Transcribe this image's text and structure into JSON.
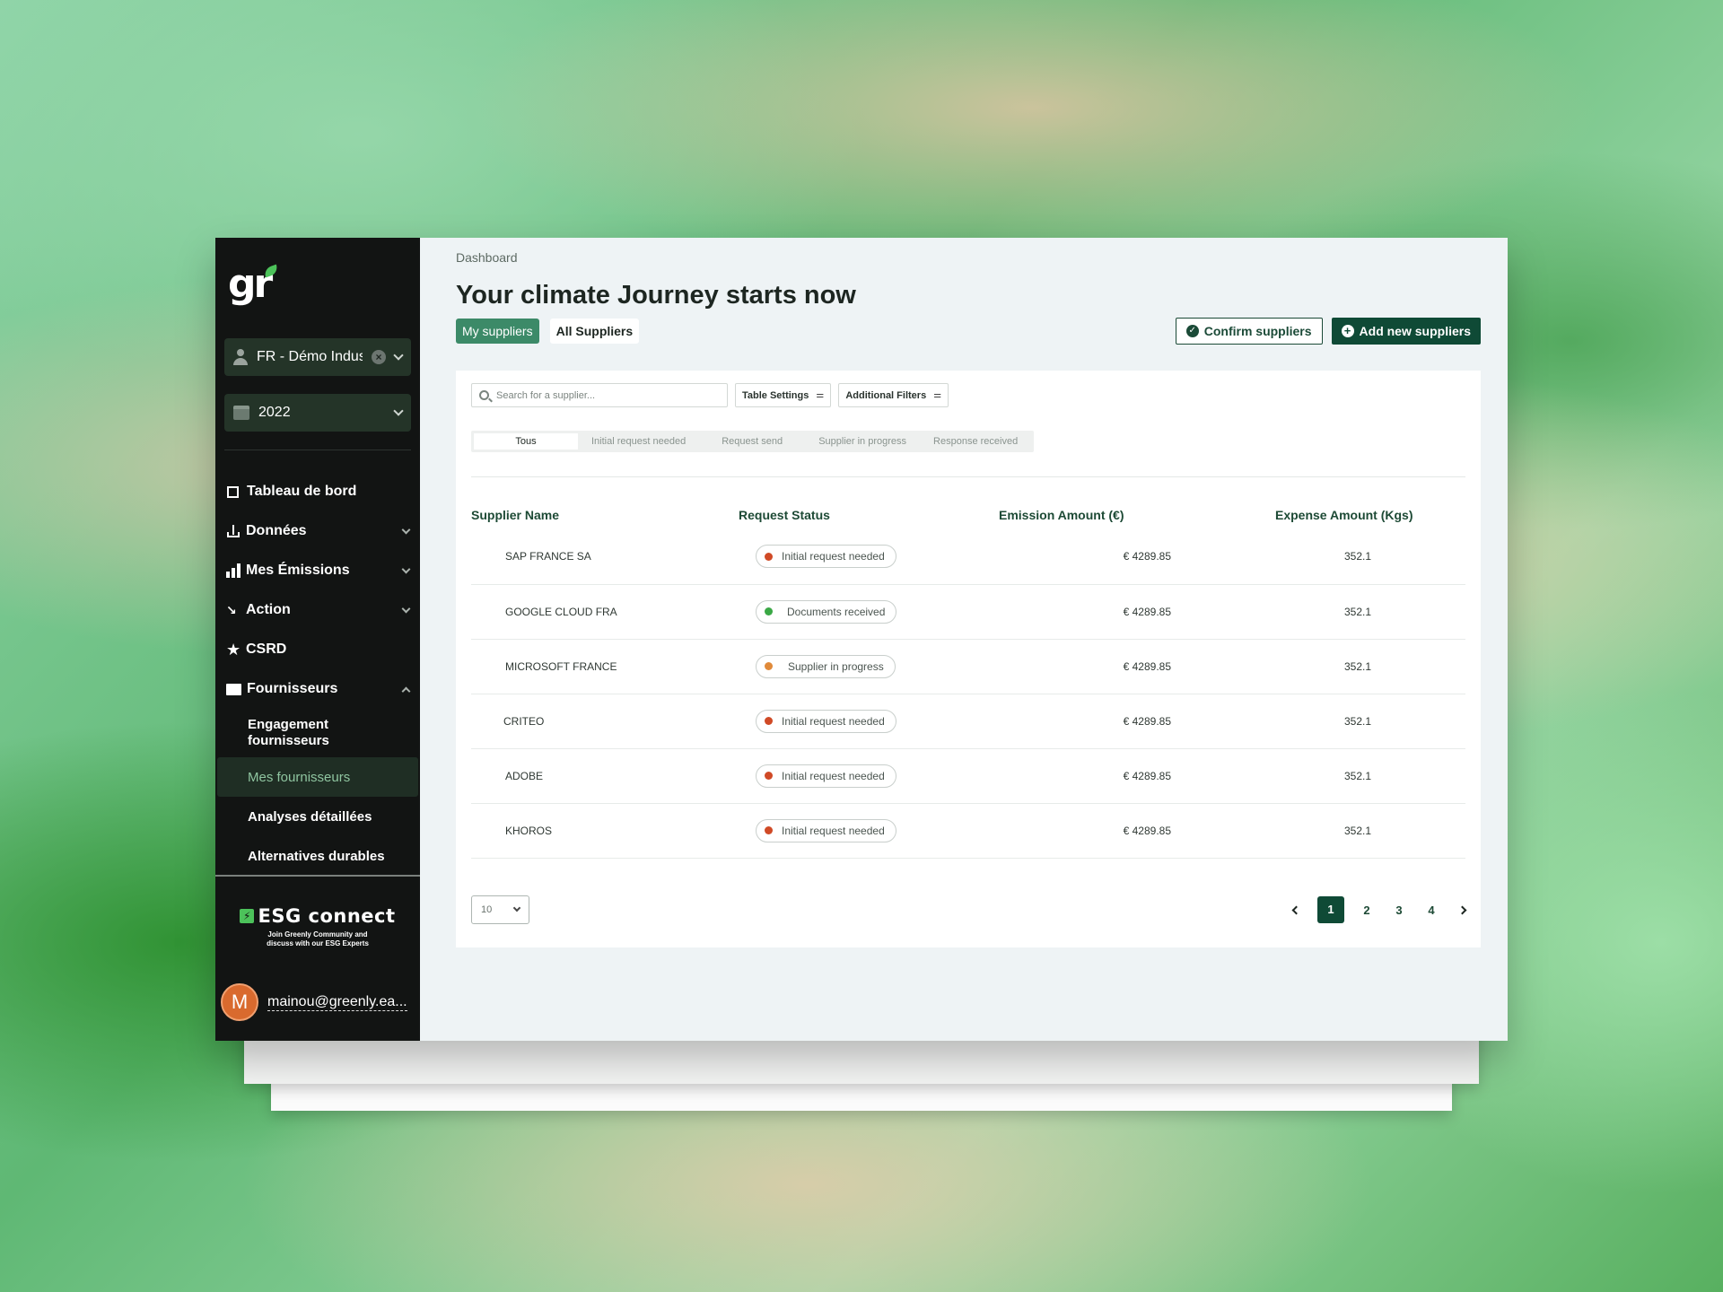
{
  "sidebar": {
    "logo": "gr",
    "company_select": "FR - Démo Industrie",
    "year_select": "2022",
    "nav": [
      {
        "label": "Tableau de bord"
      },
      {
        "label": "Données"
      },
      {
        "label": "Mes Émissions"
      },
      {
        "label": "Action"
      },
      {
        "label": "CSRD"
      },
      {
        "label": "Fournisseurs"
      }
    ],
    "sub_nav": [
      {
        "label": "Engagement fournisseurs"
      },
      {
        "label": "Mes fournisseurs"
      },
      {
        "label": "Analyses détaillées"
      },
      {
        "label": "Alternatives durables"
      }
    ],
    "esg_title": "ESG connect",
    "esg_sub_1": "Join Greenly Community and",
    "esg_sub_2": "discuss with our ESG Experts",
    "user_initial": "M",
    "user_email": "mainou@greenly.ea..."
  },
  "main": {
    "breadcrumb": "Dashboard",
    "title": "Your climate Journey starts now",
    "tabs": [
      {
        "label": "My suppliers"
      },
      {
        "label": "All Suppliers"
      }
    ],
    "confirm_label": "Confirm suppliers",
    "add_label": "Add new suppliers",
    "search_placeholder": "Search for a supplier...",
    "table_settings": "Table Settings",
    "additional_filters": "Additional Filters",
    "status_tabs": [
      {
        "label": "Tous"
      },
      {
        "label": "Initial request needed"
      },
      {
        "label": "Request send"
      },
      {
        "label": "Supplier in progress"
      },
      {
        "label": "Response received"
      }
    ],
    "columns": [
      "Supplier Name",
      "Request Status",
      "Emission Amount (€)",
      "Expense Amount (Kgs)"
    ],
    "rows": [
      {
        "name": "SAP FRANCE SA",
        "status": "Initial request needed",
        "emission": "€ 4289.85",
        "expense": "352.1"
      },
      {
        "name": "GOOGLE CLOUD FRA",
        "status": "Documents received",
        "emission": "€ 4289.85",
        "expense": "352.1"
      },
      {
        "name": "MICROSOFT FRANCE",
        "status": "Supplier in progress",
        "emission": "€ 4289.85",
        "expense": "352.1"
      },
      {
        "name": "CRITEO",
        "status": "Initial request needed",
        "emission": "€ 4289.85",
        "expense": "352.1"
      },
      {
        "name": "ADOBE",
        "status": "Initial request needed",
        "emission": "€ 4289.85",
        "expense": "352.1"
      },
      {
        "name": "KHOROS",
        "status": "Initial request needed",
        "emission": "€ 4289.85",
        "expense": "352.1"
      }
    ],
    "page_size": "10",
    "pages": [
      "1",
      "2",
      "3",
      "4"
    ]
  },
  "colors": {
    "status_red": "#d04a26",
    "status_green": "#3aa845",
    "status_orange": "#e08a3a",
    "accent_dark": "#0f4a36",
    "accent_tab": "#3c8a68"
  }
}
